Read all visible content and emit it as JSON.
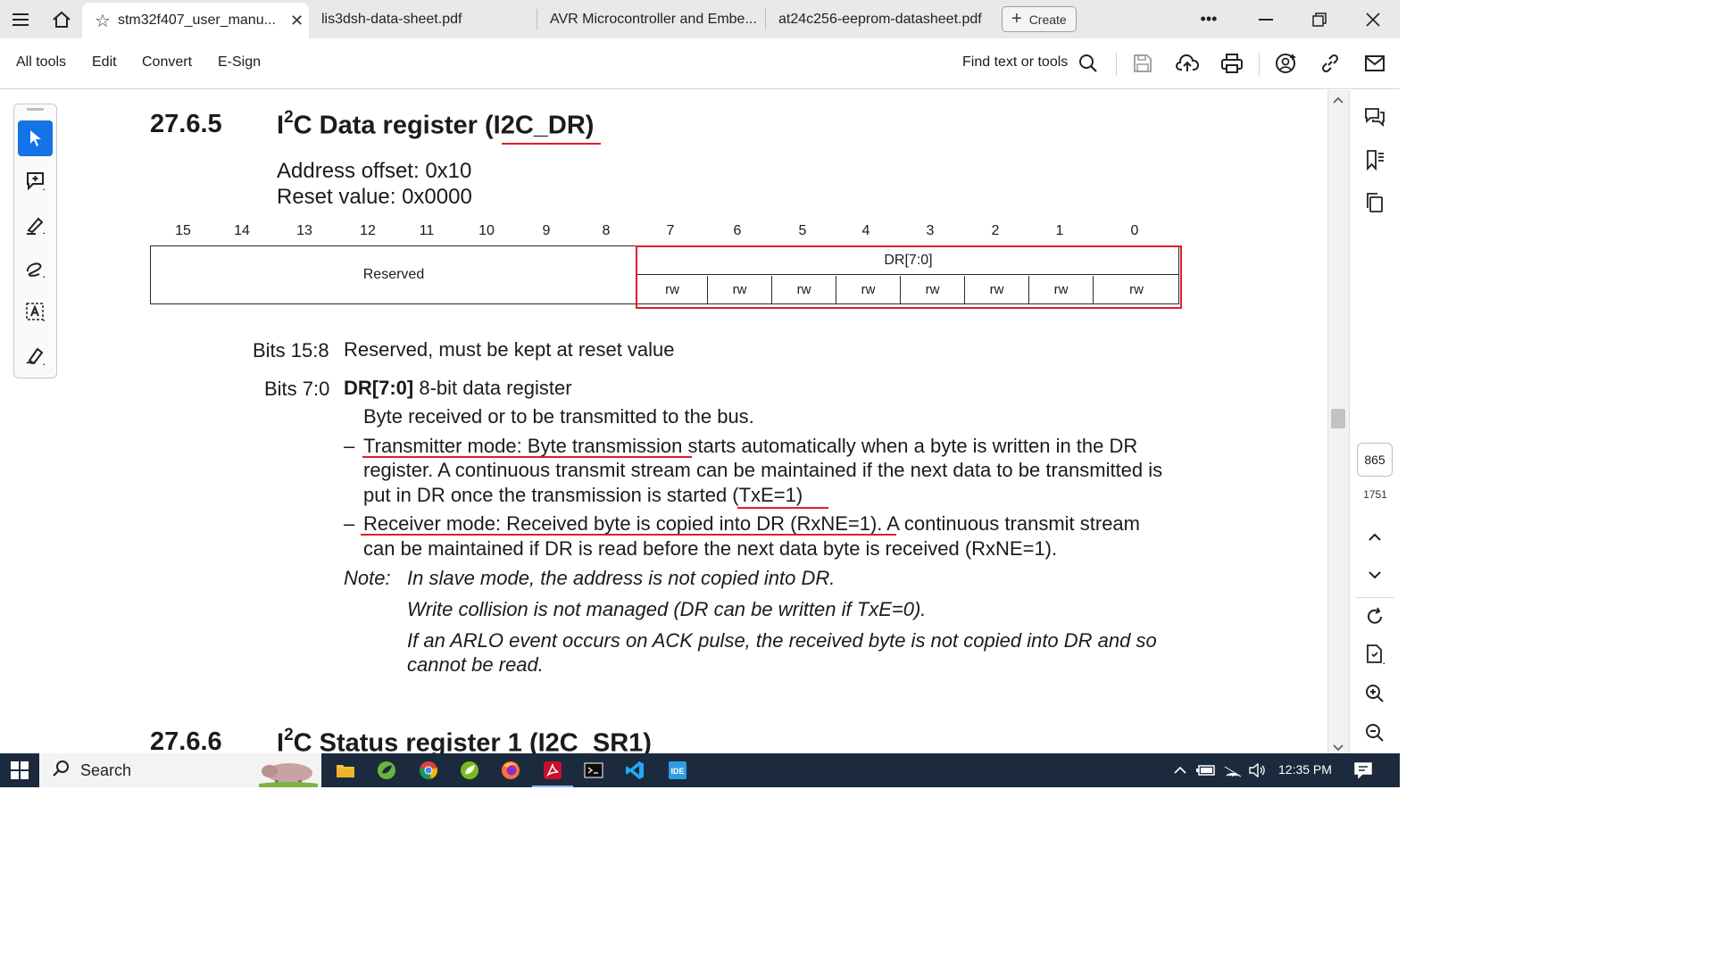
{
  "tabs": [
    {
      "label": "stm32f407_user_manu...",
      "active": true
    },
    {
      "label": "lis3dsh-data-sheet.pdf",
      "active": false
    },
    {
      "label": "AVR Microcontroller and Embe...",
      "active": false
    },
    {
      "label": "at24c256-eeprom-datasheet.pdf",
      "active": false
    }
  ],
  "create_label": "Create",
  "menu": [
    "All tools",
    "Edit",
    "Convert",
    "E-Sign"
  ],
  "find_label": "Find text or tools",
  "doc": {
    "section_num": "27.6.5",
    "section_title_pre": "I",
    "section_title_sup": "2",
    "section_title_post": "C Data register (I2C_DR)",
    "address_offset": "Address offset: 0x10",
    "reset_value": "Reset value: 0x0000",
    "bit_numbers": [
      "15",
      "14",
      "13",
      "12",
      "11",
      "10",
      "9",
      "8",
      "7",
      "6",
      "5",
      "4",
      "3",
      "2",
      "1",
      "0"
    ],
    "reserved_label": "Reserved",
    "dr_label": "DR[7:0]",
    "rw_label": "rw",
    "bits_15_8_label": "Bits 15:8",
    "bits_15_8_text": "Reserved, must be kept at reset value",
    "bits_7_0_label": "Bits 7:0",
    "bits_7_0_name": "DR[7:0]",
    "bits_7_0_text": " 8-bit data register",
    "line_byte": "Byte received or to be transmitted to the bus.",
    "dash": "–",
    "tx_line1": "Transmitter mode: Byte transmission starts automatically when a byte is written in the DR",
    "tx_line2": "register. A continuous transmit stream can be maintained if the next data to be transmitted is",
    "tx_line3": "put in DR once the transmission is started (TxE=1)",
    "rx_line1": "Receiver mode: Received byte is copied into DR (RxNE=1). A continuous transmit stream",
    "rx_line2": "can be maintained if DR is read before the next data byte is received (RxNE=1).",
    "note_label": "Note:",
    "note1": "In slave mode, the address is not copied into DR.",
    "note2": "Write collision is not managed (DR can be written if TxE=0).",
    "note3a": "If an ARLO event occurs on ACK pulse, the received byte is not copied into DR and so",
    "note3b": "cannot be read.",
    "next_section_num": "27.6.6",
    "next_title_pre": "I",
    "next_title_sup": "2",
    "next_title_post": "C Status register 1 (I2C_SR1)"
  },
  "page_current": "865",
  "page_total": "1751",
  "taskbar": {
    "search_label": "Search",
    "time": "12:35 PM"
  },
  "colors": {
    "annotation_red": "#e31e24",
    "selected_tool_blue": "#1473e6",
    "taskbar_bg": "#1c2a3e"
  }
}
